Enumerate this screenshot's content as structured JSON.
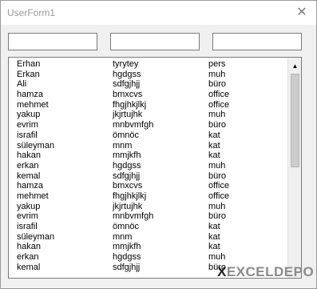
{
  "window": {
    "title": "UserForm1",
    "close_glyph": "✕"
  },
  "textboxes": [
    {
      "value": ""
    },
    {
      "value": ""
    },
    {
      "value": ""
    }
  ],
  "listbox": {
    "rows": [
      [
        "Erhan",
        "tyrytey",
        "pers"
      ],
      [
        "Erkan",
        "hgdgss",
        "muh"
      ],
      [
        "Ali",
        "sdfgjhjj",
        "büro"
      ],
      [
        "hamza",
        "bmxcvs",
        "office"
      ],
      [
        "mehmet",
        "fhgjhkjlkj",
        "office"
      ],
      [
        "yakup",
        "jkjrtujhk",
        "muh"
      ],
      [
        "evrim",
        "mnbvmfgh",
        "büro"
      ],
      [
        "israfil",
        "ömnöc",
        "kat"
      ],
      [
        "süleyman",
        "mnm",
        "kat"
      ],
      [
        "hakan",
        "mmjkfh",
        "kat"
      ],
      [
        "erkan",
        "hgdgss",
        "muh"
      ],
      [
        "kemal",
        "sdfgjhjj",
        "büro"
      ],
      [
        "hamza",
        "bmxcvs",
        "office"
      ],
      [
        "mehmet",
        "fhgjhkjlkj",
        "office"
      ],
      [
        "yakup",
        "jkjrtujhk",
        "muh"
      ],
      [
        "evrim",
        "mnbvmfgh",
        "büro"
      ],
      [
        "israfil",
        "ömnöc",
        "kat"
      ],
      [
        "süleyman",
        "mnm",
        "kat"
      ],
      [
        "hakan",
        "mmjkfh",
        "kat"
      ],
      [
        "erkan",
        "hgdgss",
        "muh"
      ],
      [
        "kemal",
        "sdfgjhjj",
        "büro"
      ]
    ],
    "scrollbar": {
      "up_arrow_icon": "scroll-up-arrow",
      "up_glyph": "▲"
    }
  },
  "watermark": {
    "mark": "X",
    "text": "EXCELDEPO"
  },
  "colors": {
    "title_text": "#9a9a9a",
    "logo_gray": "#8a8a8a",
    "logo_dark": "#1d1d1b"
  }
}
